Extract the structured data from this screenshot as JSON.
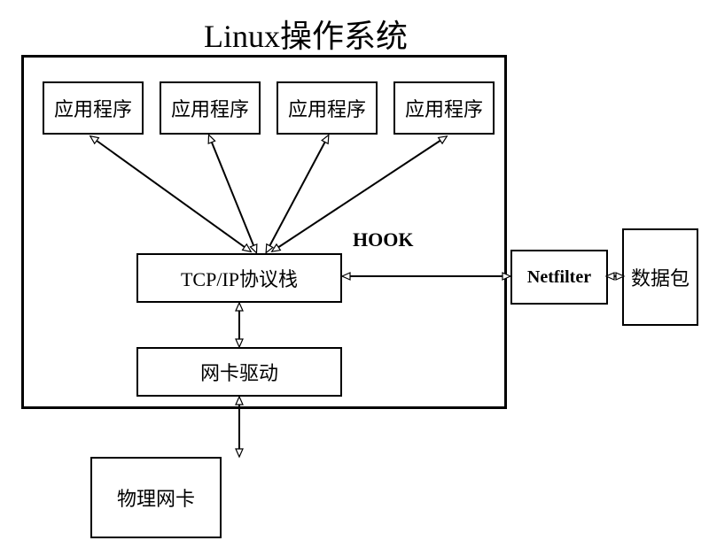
{
  "title": "Linux操作系统",
  "apps": {
    "app1": "应用程序",
    "app2": "应用程序",
    "app3": "应用程序",
    "app4": "应用程序"
  },
  "tcpip": "TCP/IP协议栈",
  "nic_driver": "网卡驱动",
  "physical_nic": "物理网卡",
  "netfilter": "Netfilter",
  "packet": "数据包",
  "hook_label": "HOOK"
}
